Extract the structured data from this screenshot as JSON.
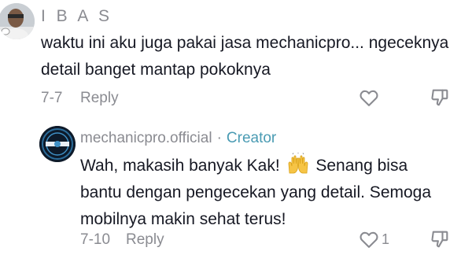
{
  "comments": [
    {
      "username": "I B A S",
      "text": "waktu ini aku juga pakai jasa mechanicpro... ngeceknya detail banget mantap pokoknya",
      "date": "7-7",
      "reply_label": "Reply",
      "like_count": ""
    }
  ],
  "reply": {
    "username": "mechanicpro.official",
    "separator": "·",
    "badge": "Creator",
    "text_before_emoji": "Wah, makasih banyak Kak!",
    "emoji": "raising-hands",
    "text_after_emoji": "Senang bisa bantu dengan pengecekan yang detail. Semoga mobilnya makin sehat terus!",
    "date": "7-10",
    "reply_label": "Reply",
    "like_count": "1"
  },
  "icons": {
    "like": "heart-outline-icon",
    "dislike": "thumbs-down-outline-icon"
  },
  "colors": {
    "text": "#161823",
    "muted": "#8a8b91",
    "creator_badge": "#4a9bb3"
  }
}
